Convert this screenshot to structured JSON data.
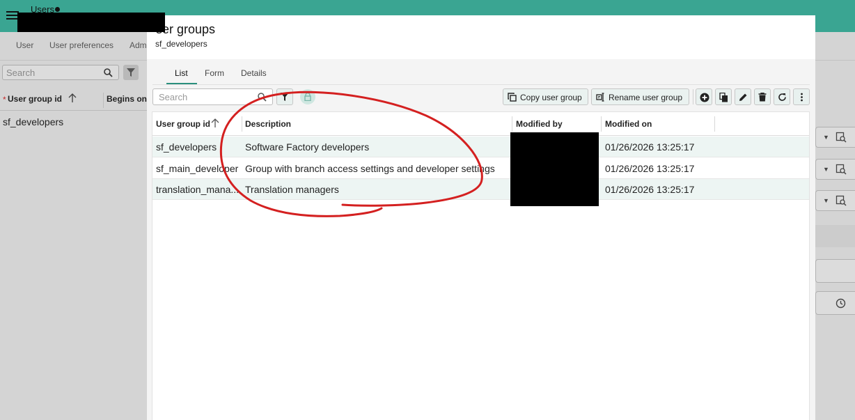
{
  "background": {
    "app_title": "Users",
    "tabs": [
      "User",
      "User preferences",
      "Adm"
    ],
    "search_placeholder": "Search",
    "columns": {
      "col1": "User group id",
      "col2": "Begins on"
    },
    "rows": [
      "sf_developers"
    ]
  },
  "modal": {
    "title": "ser groups",
    "subtitle": "sf_developers",
    "tabs": [
      {
        "label": "List",
        "active": true
      },
      {
        "label": "Form",
        "active": false
      },
      {
        "label": "Details",
        "active": false
      }
    ],
    "search_placeholder": "Search",
    "toolbar": {
      "copy_label": "Copy user group",
      "rename_label": "Rename user group"
    },
    "table": {
      "headers": [
        "User group id",
        "Description",
        "Modified by",
        "Modified on"
      ],
      "rows": [
        [
          "sf_developers",
          "Software Factory developers",
          "",
          "01/26/2026 13:25:17"
        ],
        [
          "sf_main_developer",
          "Group with branch access settings and developer settings",
          "",
          "01/26/2026 13:25:17"
        ],
        [
          "translation_mana...",
          "Translation managers",
          "",
          "01/26/2026 13:25:17"
        ]
      ]
    }
  },
  "icons": [
    "menu-icon",
    "search-icon",
    "filter-icon",
    "lock-icon",
    "copy-icon",
    "rename-icon",
    "add-icon",
    "duplicate-icon",
    "edit-icon",
    "delete-icon",
    "refresh-icon",
    "more-icon",
    "sort-asc-icon",
    "dropdown-icon",
    "lookup-icon",
    "clock-icon"
  ],
  "colors": {
    "brand": "#3aa592",
    "accent": "#2a8f7d",
    "annotation": "#d42020"
  }
}
